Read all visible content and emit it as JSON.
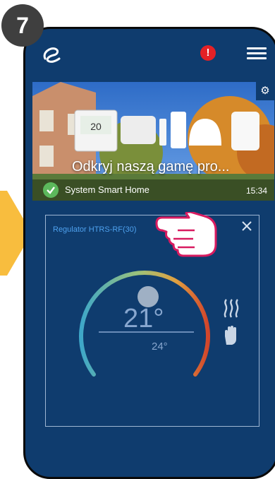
{
  "step_number": "7",
  "appbar": {
    "alert_badge": "!"
  },
  "banner": {
    "title": "Odkryj naszą gamę pro...",
    "subtitle": "System Smart Home",
    "time": "15:34",
    "settings_icon": "gear-icon",
    "status_icon": "check-circle-icon"
  },
  "regulator_card": {
    "title": "Regulator HTRS-RF(30)",
    "current_temp": "21°",
    "set_temp": "24°",
    "mode_icons": [
      "heating-icon",
      "manual-hand-icon"
    ]
  },
  "colors": {
    "background": "#0f3c6e",
    "alert": "#e42126",
    "accent_text": "#4ea1ee",
    "dial_cold": "#3ea7c8",
    "dial_hot": "#d2452b"
  }
}
